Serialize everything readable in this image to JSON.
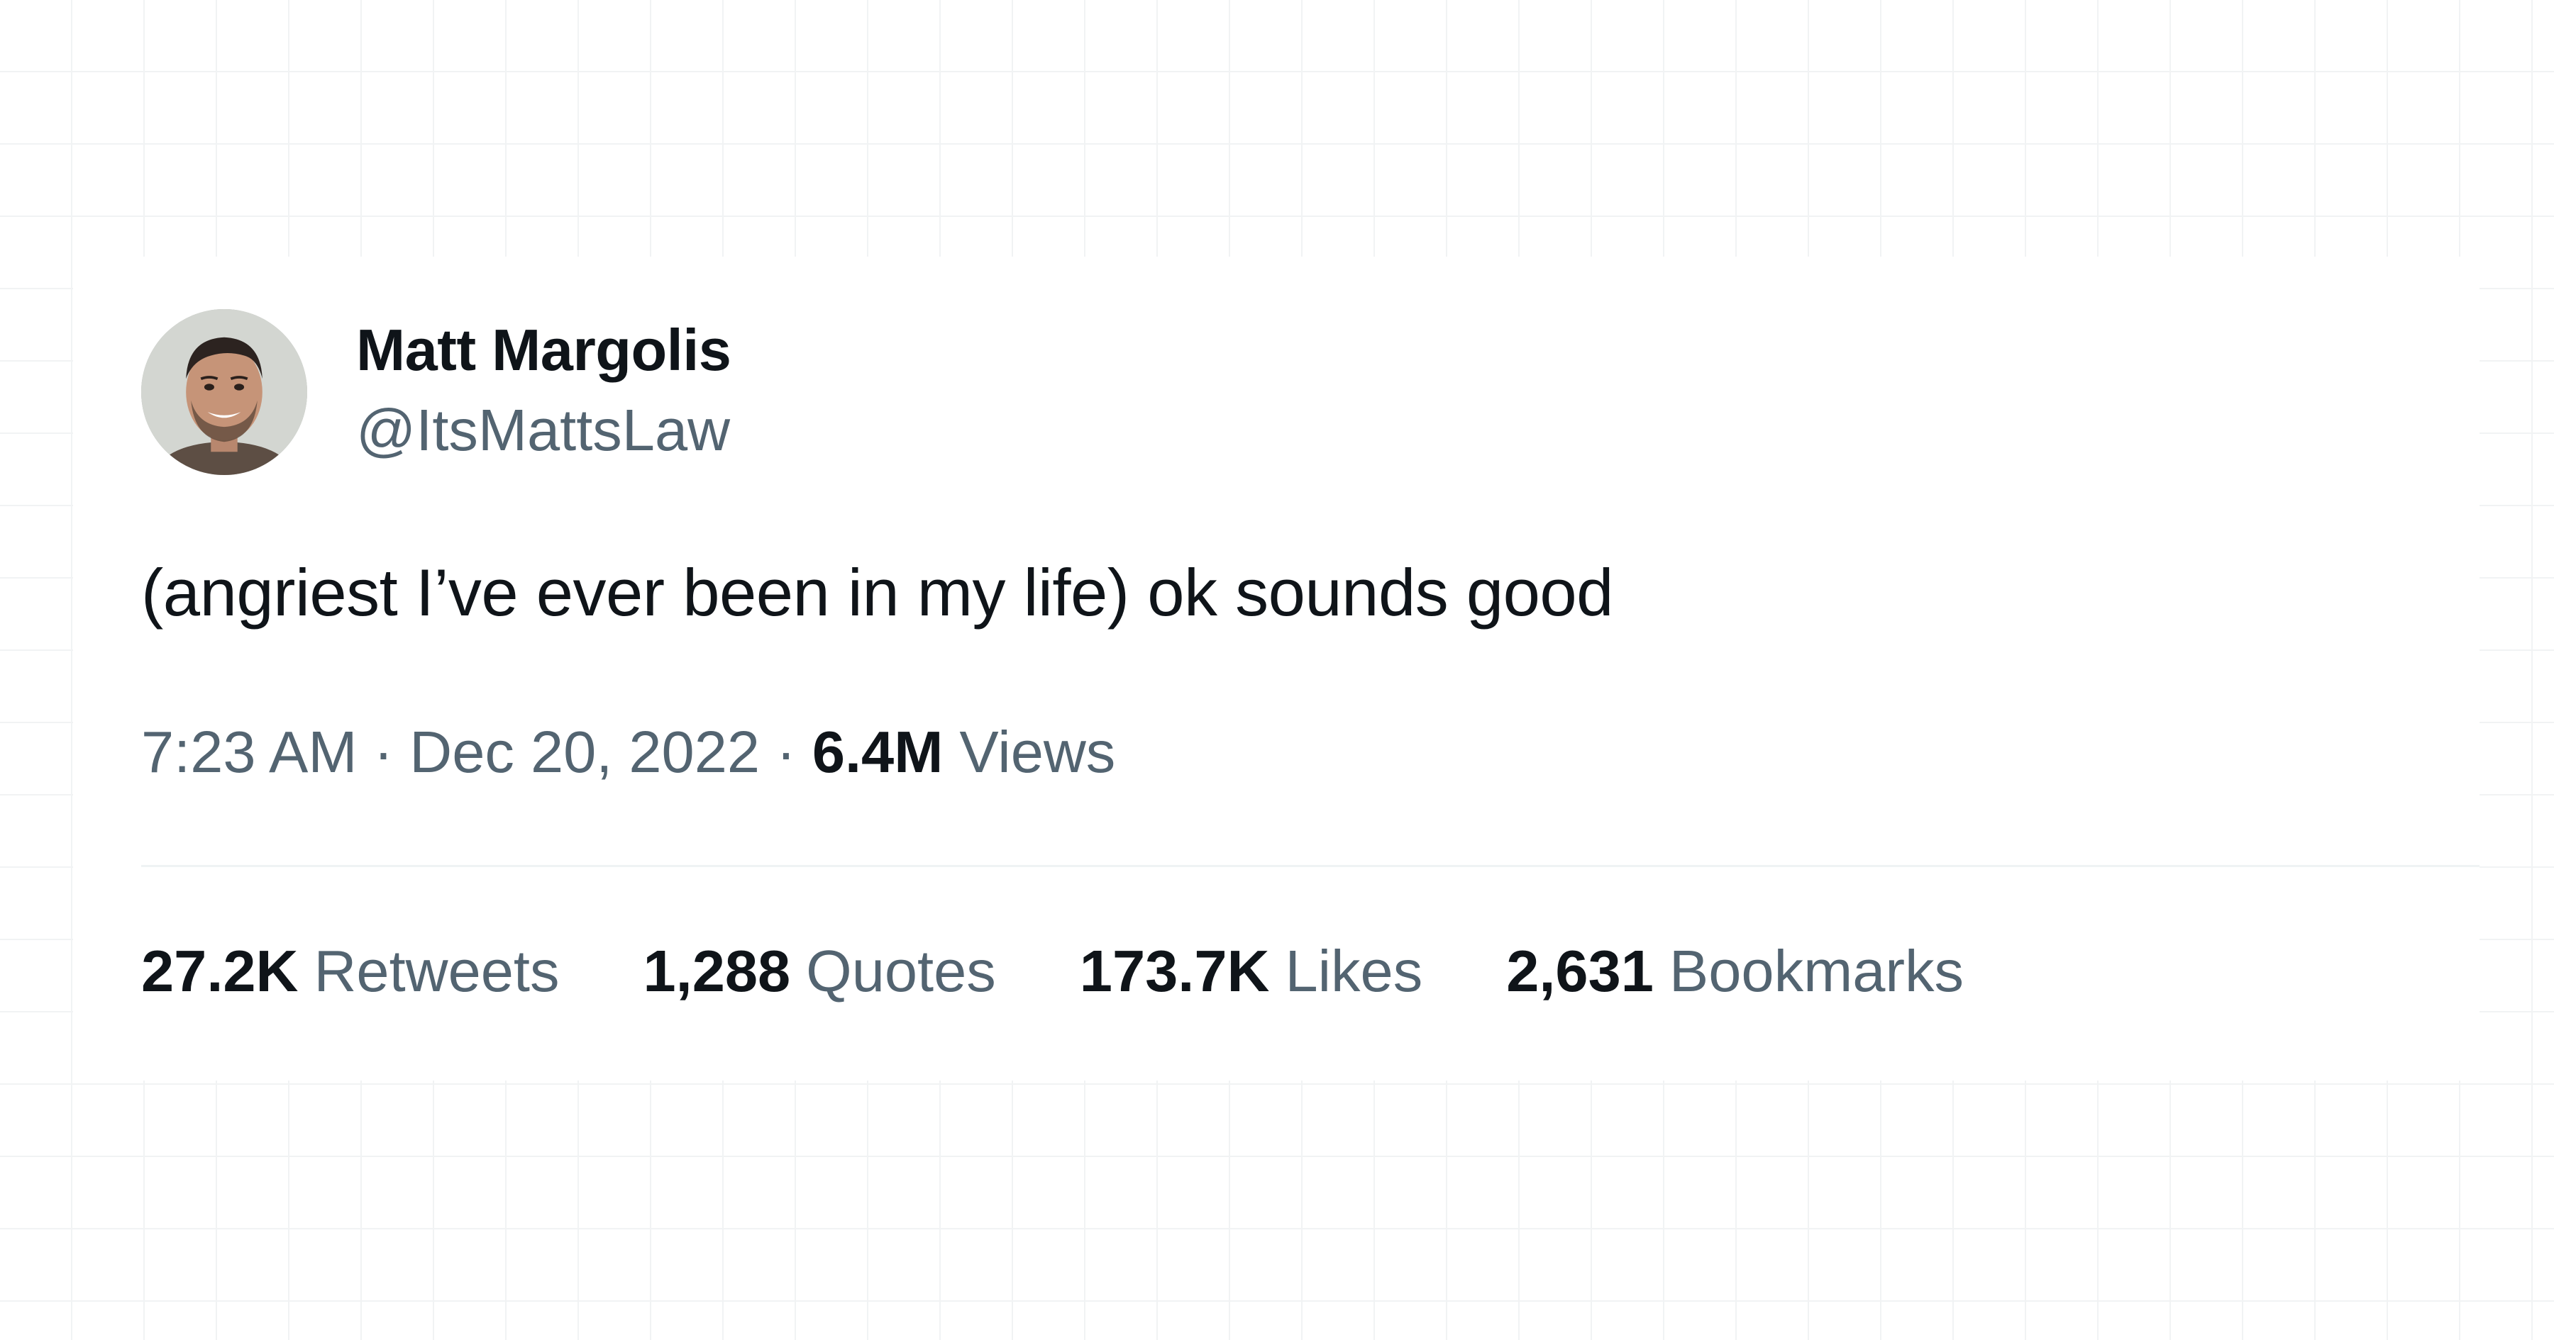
{
  "author": {
    "display_name": "Matt Margolis",
    "handle": "@ItsMattsLaw",
    "avatar_icon": "user-avatar-photo"
  },
  "tweet": {
    "text": "(angriest I’ve ever been in my life) ok sounds good",
    "time": "7:23 AM",
    "date": "Dec 20, 2022",
    "separator": "·",
    "views_count": "6.4M",
    "views_label": "Views"
  },
  "stats": {
    "retweets": {
      "count": "27.2K",
      "label": "Retweets"
    },
    "quotes": {
      "count": "1,288",
      "label": "Quotes"
    },
    "likes": {
      "count": "173.7K",
      "label": "Likes"
    },
    "bookmarks": {
      "count": "2,631",
      "label": "Bookmarks"
    }
  },
  "colors": {
    "text_primary": "#0f1419",
    "text_secondary": "#536471",
    "divider": "#eff3f4",
    "grid_background": "#f1f3f4"
  }
}
